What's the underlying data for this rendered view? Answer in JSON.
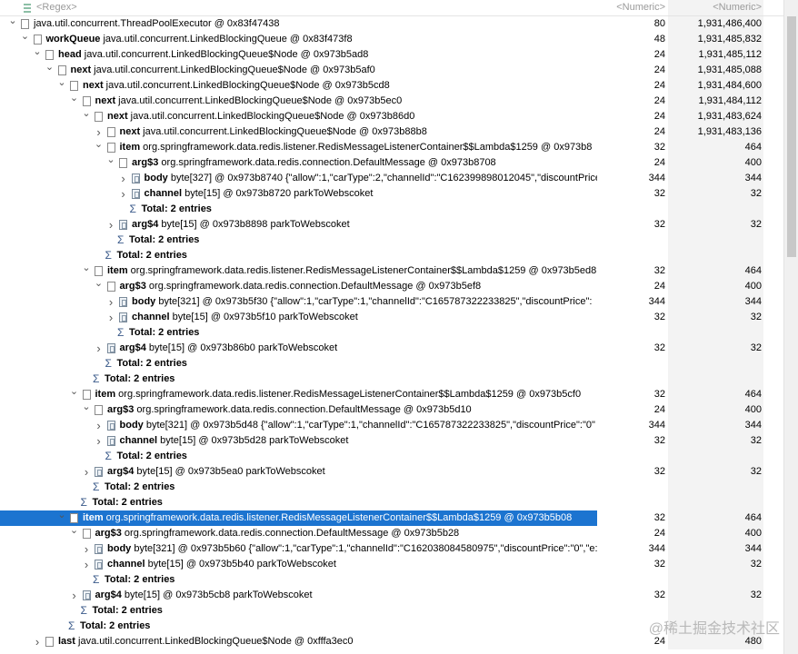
{
  "header": {
    "regex": "<Regex>",
    "shallow": "<Numeric>",
    "retained": "<Numeric>"
  },
  "rows": [
    {
      "d": 0,
      "tw": "v",
      "ic": "o",
      "name": "",
      "type": "java.util.concurrent.ThreadPoolExecutor @ 0x83f47438",
      "value": "",
      "shallow": "80",
      "retained": "1,931,486,400"
    },
    {
      "d": 1,
      "tw": "v",
      "ic": "o",
      "name": "workQueue",
      "type": "java.util.concurrent.LinkedBlockingQueue @ 0x83f473f8",
      "value": "",
      "shallow": "48",
      "retained": "1,931,485,832"
    },
    {
      "d": 2,
      "tw": "v",
      "ic": "o",
      "name": "head",
      "type": "java.util.concurrent.LinkedBlockingQueue$Node @ 0x973b5ad8",
      "value": "",
      "shallow": "24",
      "retained": "1,931,485,112"
    },
    {
      "d": 3,
      "tw": "v",
      "ic": "o",
      "name": "next",
      "type": "java.util.concurrent.LinkedBlockingQueue$Node @ 0x973b5af0",
      "value": "",
      "shallow": "24",
      "retained": "1,931,485,088"
    },
    {
      "d": 4,
      "tw": "v",
      "ic": "o",
      "name": "next",
      "type": "java.util.concurrent.LinkedBlockingQueue$Node @ 0x973b5cd8",
      "value": "",
      "shallow": "24",
      "retained": "1,931,484,600"
    },
    {
      "d": 5,
      "tw": "v",
      "ic": "o",
      "name": "next",
      "type": "java.util.concurrent.LinkedBlockingQueue$Node @ 0x973b5ec0",
      "value": "",
      "shallow": "24",
      "retained": "1,931,484,112"
    },
    {
      "d": 6,
      "tw": "v",
      "ic": "o",
      "name": "next",
      "type": "java.util.concurrent.LinkedBlockingQueue$Node @ 0x973b86d0",
      "value": "",
      "shallow": "24",
      "retained": "1,931,483,624"
    },
    {
      "d": 7,
      "tw": ">",
      "ic": "o",
      "name": "next",
      "type": "java.util.concurrent.LinkedBlockingQueue$Node @ 0x973b88b8",
      "value": "",
      "shallow": "24",
      "retained": "1,931,483,136"
    },
    {
      "d": 7,
      "tw": "v",
      "ic": "o",
      "name": "item",
      "type": "org.springframework.data.redis.listener.RedisMessageListenerContainer$$Lambda$1259 @ 0x973b8",
      "value": "",
      "shallow": "32",
      "retained": "464"
    },
    {
      "d": 8,
      "tw": "v",
      "ic": "o",
      "name": "arg$3",
      "type": "org.springframework.data.redis.connection.DefaultMessage @ 0x973b8708",
      "value": "",
      "shallow": "24",
      "retained": "400"
    },
    {
      "d": 9,
      "tw": ">",
      "ic": "a",
      "name": "body",
      "type": "byte[327] @ 0x973b8740",
      "value": " {\"allow\":1,\"carType\":2,\"channelId\":\"C162399898012045\",\"discountPrice",
      "shallow": "344",
      "retained": "344"
    },
    {
      "d": 9,
      "tw": ">",
      "ic": "a",
      "name": "channel",
      "type": "byte[15] @ 0x973b8720",
      "value": "  parkToWebscoket",
      "shallow": "32",
      "retained": "32"
    },
    {
      "d": 9,
      "tw": "",
      "ic": "s",
      "name": "Total: 2 entries",
      "type": "",
      "value": "",
      "shallow": "",
      "retained": ""
    },
    {
      "d": 8,
      "tw": ">",
      "ic": "a",
      "name": "arg$4",
      "type": "byte[15] @ 0x973b8898",
      "value": "  parkToWebscoket",
      "shallow": "32",
      "retained": "32"
    },
    {
      "d": 8,
      "tw": "",
      "ic": "s",
      "name": "Total: 2 entries",
      "type": "",
      "value": "",
      "shallow": "",
      "retained": ""
    },
    {
      "d": 7,
      "tw": "",
      "ic": "s",
      "name": "Total: 2 entries",
      "type": "",
      "value": "",
      "shallow": "",
      "retained": ""
    },
    {
      "d": 6,
      "tw": "v",
      "ic": "o",
      "name": "item",
      "type": "org.springframework.data.redis.listener.RedisMessageListenerContainer$$Lambda$1259 @ 0x973b5ed8",
      "value": "",
      "shallow": "32",
      "retained": "464"
    },
    {
      "d": 7,
      "tw": "v",
      "ic": "o",
      "name": "arg$3",
      "type": "org.springframework.data.redis.connection.DefaultMessage @ 0x973b5ef8",
      "value": "",
      "shallow": "24",
      "retained": "400"
    },
    {
      "d": 8,
      "tw": ">",
      "ic": "a",
      "name": "body",
      "type": "byte[321] @ 0x973b5f30",
      "value": " {\"allow\":1,\"carType\":1,\"channelId\":\"C165787322233825\",\"discountPrice\":",
      "shallow": "344",
      "retained": "344"
    },
    {
      "d": 8,
      "tw": ">",
      "ic": "a",
      "name": "channel",
      "type": "byte[15] @ 0x973b5f10",
      "value": "  parkToWebscoket",
      "shallow": "32",
      "retained": "32"
    },
    {
      "d": 8,
      "tw": "",
      "ic": "s",
      "name": "Total: 2 entries",
      "type": "",
      "value": "",
      "shallow": "",
      "retained": ""
    },
    {
      "d": 7,
      "tw": ">",
      "ic": "a",
      "name": "arg$4",
      "type": "byte[15] @ 0x973b86b0",
      "value": "  parkToWebscoket",
      "shallow": "32",
      "retained": "32"
    },
    {
      "d": 7,
      "tw": "",
      "ic": "s",
      "name": "Total: 2 entries",
      "type": "",
      "value": "",
      "shallow": "",
      "retained": ""
    },
    {
      "d": 6,
      "tw": "",
      "ic": "s",
      "name": "Total: 2 entries",
      "type": "",
      "value": "",
      "shallow": "",
      "retained": ""
    },
    {
      "d": 5,
      "tw": "v",
      "ic": "o",
      "name": "item",
      "type": "org.springframework.data.redis.listener.RedisMessageListenerContainer$$Lambda$1259 @ 0x973b5cf0",
      "value": "",
      "shallow": "32",
      "retained": "464"
    },
    {
      "d": 6,
      "tw": "v",
      "ic": "o",
      "name": "arg$3",
      "type": "org.springframework.data.redis.connection.DefaultMessage @ 0x973b5d10",
      "value": "",
      "shallow": "24",
      "retained": "400"
    },
    {
      "d": 7,
      "tw": ">",
      "ic": "a",
      "name": "body",
      "type": "byte[321] @ 0x973b5d48",
      "value": " {\"allow\":1,\"carType\":1,\"channelId\":\"C165787322233825\",\"discountPrice\":\"0\"",
      "shallow": "344",
      "retained": "344"
    },
    {
      "d": 7,
      "tw": ">",
      "ic": "a",
      "name": "channel",
      "type": "byte[15] @ 0x973b5d28",
      "value": "  parkToWebscoket",
      "shallow": "32",
      "retained": "32"
    },
    {
      "d": 7,
      "tw": "",
      "ic": "s",
      "name": "Total: 2 entries",
      "type": "",
      "value": "",
      "shallow": "",
      "retained": ""
    },
    {
      "d": 6,
      "tw": ">",
      "ic": "a",
      "name": "arg$4",
      "type": "byte[15] @ 0x973b5ea0",
      "value": "  parkToWebscoket",
      "shallow": "32",
      "retained": "32"
    },
    {
      "d": 6,
      "tw": "",
      "ic": "s",
      "name": "Total: 2 entries",
      "type": "",
      "value": "",
      "shallow": "",
      "retained": ""
    },
    {
      "d": 5,
      "tw": "",
      "ic": "s",
      "name": "Total: 2 entries",
      "type": "",
      "value": "",
      "shallow": "",
      "retained": ""
    },
    {
      "d": 4,
      "tw": "v",
      "ic": "o",
      "name": "item",
      "type": "org.springframework.data.redis.listener.RedisMessageListenerContainer$$Lambda$1259 @ 0x973b5b08",
      "value": "",
      "shallow": "32",
      "retained": "464",
      "sel": true
    },
    {
      "d": 5,
      "tw": "v",
      "ic": "o",
      "name": "arg$3",
      "type": "org.springframework.data.redis.connection.DefaultMessage @ 0x973b5b28",
      "value": "",
      "shallow": "24",
      "retained": "400"
    },
    {
      "d": 6,
      "tw": ">",
      "ic": "a",
      "name": "body",
      "type": "byte[321] @ 0x973b5b60",
      "value": " {\"allow\":1,\"carType\":1,\"channelId\":\"C162038084580975\",\"discountPrice\":\"0\",\"e:",
      "shallow": "344",
      "retained": "344"
    },
    {
      "d": 6,
      "tw": ">",
      "ic": "a",
      "name": "channel",
      "type": "byte[15] @ 0x973b5b40",
      "value": "  parkToWebscoket",
      "shallow": "32",
      "retained": "32"
    },
    {
      "d": 6,
      "tw": "",
      "ic": "s",
      "name": "Total: 2 entries",
      "type": "",
      "value": "",
      "shallow": "",
      "retained": ""
    },
    {
      "d": 5,
      "tw": ">",
      "ic": "a",
      "name": "arg$4",
      "type": "byte[15] @ 0x973b5cb8",
      "value": "  parkToWebscoket",
      "shallow": "32",
      "retained": "32"
    },
    {
      "d": 5,
      "tw": "",
      "ic": "s",
      "name": "Total: 2 entries",
      "type": "",
      "value": "",
      "shallow": "",
      "retained": ""
    },
    {
      "d": 4,
      "tw": "",
      "ic": "s",
      "name": "Total: 2 entries",
      "type": "",
      "value": "",
      "shallow": "",
      "retained": ""
    },
    {
      "d": 2,
      "tw": ">",
      "ic": "o",
      "name": "last",
      "type": "java.util.concurrent.LinkedBlockingQueue$Node @ 0xfffa3ec0",
      "value": "",
      "shallow": "24",
      "retained": "480"
    }
  ],
  "watermark": "@稀土掘金技术社区"
}
